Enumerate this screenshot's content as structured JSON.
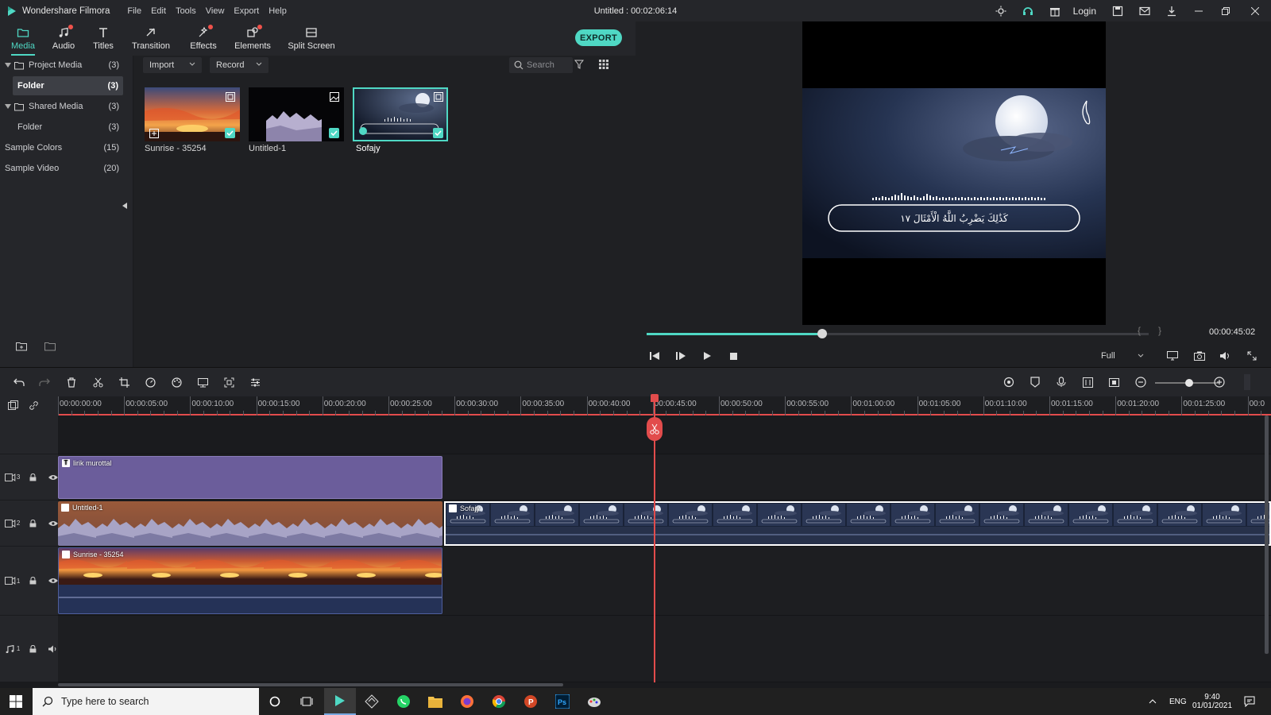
{
  "app": {
    "name": "Wondershare Filmora",
    "document_title": "Untitled : 00:02:06:14",
    "menu": [
      "File",
      "Edit",
      "Tools",
      "View",
      "Export",
      "Help"
    ],
    "login_label": "Login",
    "accent": "#4fd8c4"
  },
  "modules": {
    "tabs": [
      {
        "label": "Media",
        "icon": "folder-icon",
        "active": true
      },
      {
        "label": "Audio",
        "icon": "music-note-icon",
        "badge": true
      },
      {
        "label": "Titles",
        "icon": "text-icon"
      },
      {
        "label": "Transition",
        "icon": "transition-icon"
      },
      {
        "label": "Effects",
        "icon": "effects-icon",
        "badge": true
      },
      {
        "label": "Elements",
        "icon": "elements-icon",
        "badge": true
      },
      {
        "label": "Split Screen",
        "icon": "split-screen-icon"
      }
    ],
    "export_label": "EXPORT"
  },
  "library": {
    "items": [
      {
        "label": "Project Media",
        "count": "(3)"
      },
      {
        "label": "Folder",
        "count": "(3)"
      },
      {
        "label": "Shared Media",
        "count": "(3)"
      },
      {
        "label": "Folder",
        "count": "(3)"
      },
      {
        "label": "Sample Colors",
        "count": "(15)"
      },
      {
        "label": "Sample Video",
        "count": "(20)"
      }
    ]
  },
  "media": {
    "import_label": "Import",
    "record_label": "Record",
    "search_placeholder": "Search",
    "items": [
      {
        "name": "Sunrise - 35254",
        "type": "video"
      },
      {
        "name": "Untitled-1",
        "type": "image"
      },
      {
        "name": "Sofajy",
        "type": "video",
        "selected": true
      }
    ]
  },
  "preview": {
    "timecode": "00:00:45:02",
    "quality": "Full",
    "progress": 0.35,
    "verse_text": "كَذَٰلِكَ يَضْرِبُ اللَّهُ الْأَمْثَالَ ١٧"
  },
  "timeline": {
    "ruler_labels": [
      "00:00:00:00",
      "00:00:05:00",
      "00:00:10:00",
      "00:00:15:00",
      "00:00:20:00",
      "00:00:25:00",
      "00:00:30:00",
      "00:00:35:00",
      "00:00:40:00",
      "00:00:45:00",
      "00:00:50:00",
      "00:00:55:00",
      "00:01:00:00",
      "00:01:05:00",
      "00:01:10:00",
      "00:01:15:00",
      "00:01:20:00",
      "00:01:25:00",
      "00:0"
    ],
    "tracks": [
      {
        "id": "3",
        "kind": "video"
      },
      {
        "id": "2",
        "kind": "video"
      },
      {
        "id": "1",
        "kind": "video"
      },
      {
        "id": "1",
        "kind": "audio"
      }
    ],
    "clips": {
      "title_clip": "lirik murottal",
      "untitled_clip": "Untitled-1",
      "sofajy_clip": "Sofajy",
      "sunrise_clip": "Sunrise - 35254"
    }
  },
  "taskbar": {
    "search_placeholder": "Type here to search",
    "lang": "ENG",
    "time": "9:40",
    "date": "01/01/2021"
  }
}
